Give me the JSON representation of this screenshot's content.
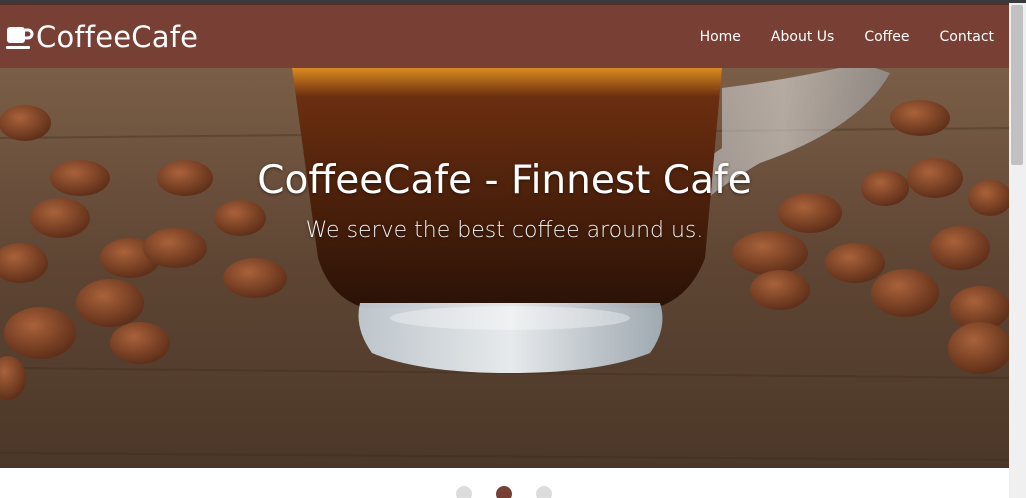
{
  "brand": {
    "name": "CoffeeCafe",
    "icon": "coffee-cup-icon"
  },
  "nav": {
    "items": [
      {
        "label": "Home"
      },
      {
        "label": "About Us"
      },
      {
        "label": "Coffee"
      },
      {
        "label": "Contact"
      }
    ]
  },
  "hero": {
    "title": "CoffeeCafe - Finnest Cafe",
    "subtitle": "We serve the best coffee around us."
  },
  "carousel": {
    "slides": 3,
    "active_index": 1
  },
  "colors": {
    "navbar": "#783f34",
    "indicator_active": "#783f34",
    "indicator_inactive": "#dcdcdc"
  }
}
